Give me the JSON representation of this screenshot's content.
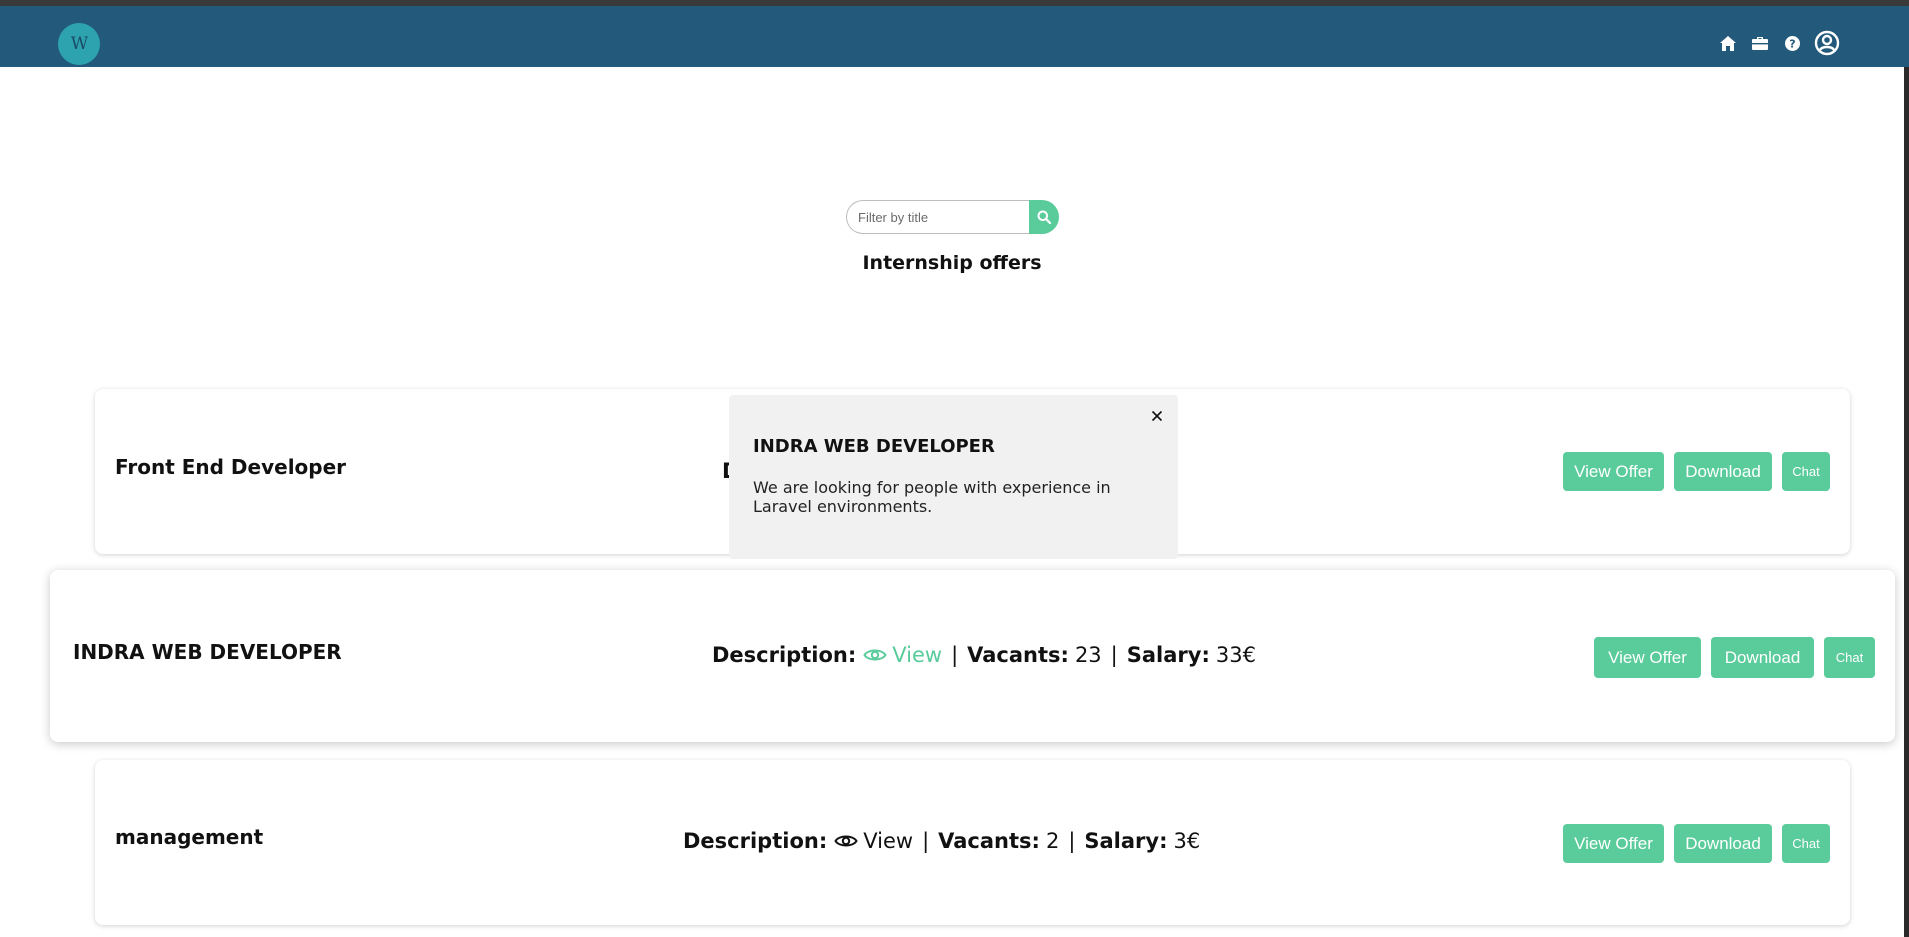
{
  "navbar": {
    "logo_text": "W",
    "icons": [
      "home-icon",
      "briefcase-icon",
      "help-icon",
      "user-icon"
    ],
    "color": "#23597a"
  },
  "search": {
    "placeholder": "Filter by title",
    "button_icon": "search-icon"
  },
  "page": {
    "title": "Internship offers"
  },
  "labels": {
    "description": "Description:",
    "view": "View",
    "vacants": "Vacants:",
    "salary": "Salary:",
    "separator": "|"
  },
  "offers": [
    {
      "title": "Front End Developer",
      "vacants": "",
      "salary": "",
      "buttons": {
        "view_offer": "View Offer",
        "download": "Download",
        "chat": "Chat"
      }
    },
    {
      "title": "INDRA WEB DEVELOPER",
      "vacants": "23",
      "salary": "33€",
      "buttons": {
        "view_offer": "View Offer",
        "download": "Download",
        "chat": "Chat"
      }
    },
    {
      "title": "management",
      "vacants": "2",
      "salary": "3€",
      "buttons": {
        "view_offer": "View Offer",
        "download": "Download",
        "chat": "Chat"
      }
    }
  ],
  "popover": {
    "title": "INDRA WEB DEVELOPER",
    "body": "We are looking for people with experience in Laravel environments."
  },
  "colors": {
    "accent": "#5acb9a",
    "popover_bg": "#f1f1f1"
  }
}
